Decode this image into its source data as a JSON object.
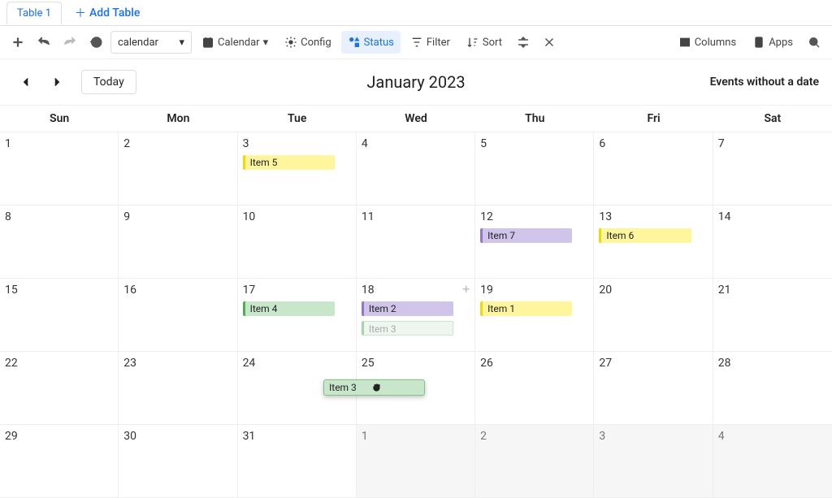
{
  "tabs": {
    "active": "Table 1",
    "add_label": "Add Table"
  },
  "toolbar": {
    "dataset": "calendar",
    "view": "Calendar",
    "config": "Config",
    "status": "Status",
    "filter": "Filter",
    "sort": "Sort",
    "columns": "Columns",
    "apps": "Apps"
  },
  "nav": {
    "today": "Today",
    "title": "January 2023",
    "no_date": "Events without a date"
  },
  "weekdays": [
    "Sun",
    "Mon",
    "Tue",
    "Wed",
    "Thu",
    "Fri",
    "Sat"
  ],
  "days": {
    "r1": [
      "1",
      "2",
      "3",
      "4",
      "5",
      "6",
      "7"
    ],
    "r2": [
      "8",
      "9",
      "10",
      "11",
      "12",
      "13",
      "14"
    ],
    "r3": [
      "15",
      "16",
      "17",
      "18",
      "19",
      "20",
      "21"
    ],
    "r4": [
      "22",
      "23",
      "24",
      "25",
      "26",
      "27",
      "28"
    ],
    "r5": [
      "29",
      "30",
      "31",
      "1",
      "2",
      "3",
      "4"
    ]
  },
  "events": {
    "item1": "Item 1",
    "item2": "Item 2",
    "item3": "Item 3",
    "item3_ghost": "Item 3",
    "item4": "Item 4",
    "item5": "Item 5",
    "item6": "Item 6",
    "item7": "Item 7"
  },
  "drag": {
    "label": "Item 3"
  }
}
